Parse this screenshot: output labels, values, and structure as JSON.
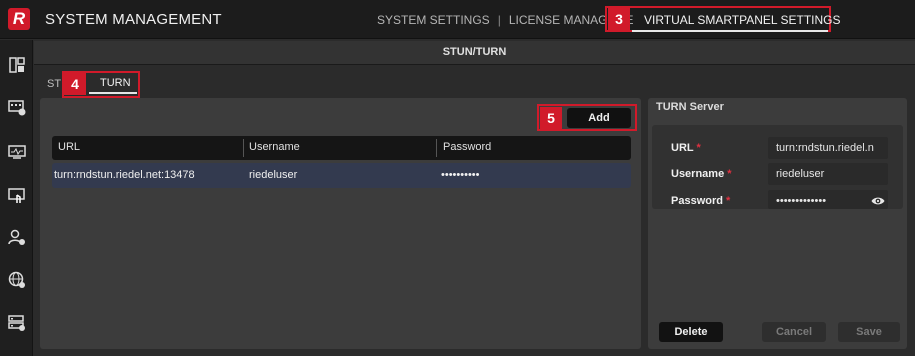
{
  "app": {
    "logo_letter": "R",
    "title": "SYSTEM MANAGEMENT"
  },
  "top_nav": {
    "items": [
      "SYSTEM SETTINGS",
      "LICENSE MANAGEME"
    ],
    "separator": "|",
    "active": "VIRTUAL SMARTPANEL SETTINGS"
  },
  "badges": {
    "nav": "3",
    "tab": "4",
    "add": "5"
  },
  "sidebar": {
    "icons": [
      "layout-icon",
      "device-add-icon",
      "monitor-icon",
      "touch-panel-icon",
      "user-settings-icon",
      "globe-settings-icon",
      "server-settings-icon"
    ]
  },
  "section": {
    "title": "STUN/TURN"
  },
  "tabs": {
    "stun_partial": "ST",
    "turn": "TURN"
  },
  "toolbar": {
    "add_label": "Add"
  },
  "table": {
    "columns": [
      "URL",
      "Username",
      "Password"
    ],
    "rows": [
      {
        "url": "turn:rndstun.riedel.net:13478",
        "username": "riedeluser",
        "password": "••••••••••"
      }
    ]
  },
  "turn_server": {
    "title": "TURN Server",
    "required_marker": "*",
    "url_label": "URL",
    "url_value": "turn:rndstun.riedel.n",
    "username_label": "Username",
    "username_value": "riedeluser",
    "password_label": "Password",
    "password_value": "•••••••••••••"
  },
  "buttons": {
    "delete": "Delete",
    "cancel": "Cancel",
    "save": "Save"
  },
  "colors": {
    "accent": "#d11a2a",
    "selected_row": "#333a4f",
    "required": "#e03040"
  }
}
